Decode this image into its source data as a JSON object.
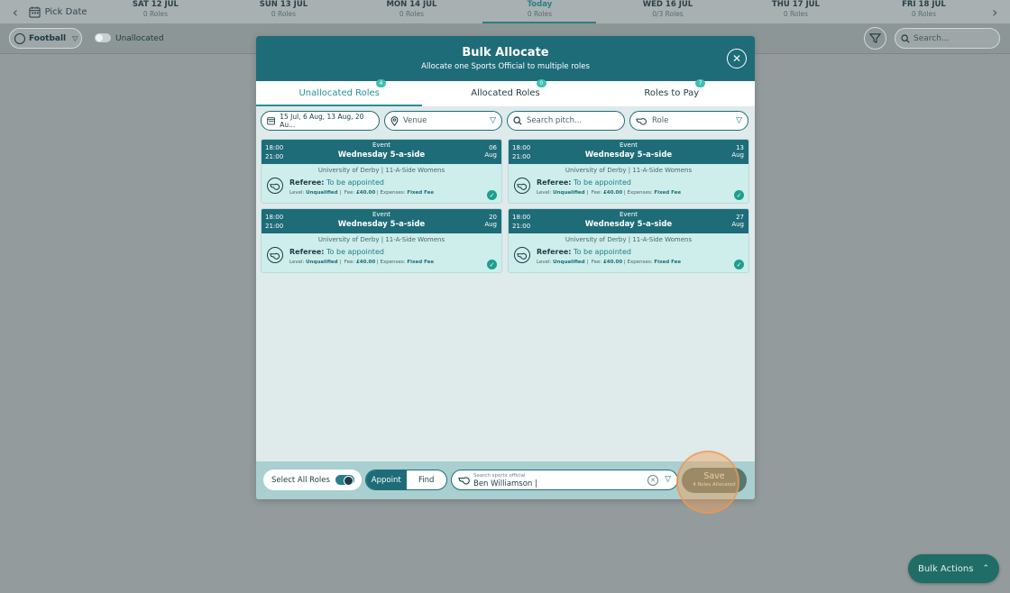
{
  "datebar": {
    "pick_date": "Pick Date",
    "days": [
      {
        "name": "SAT 12 JUL",
        "roles": "0 Roles"
      },
      {
        "name": "SUN 13 JUL",
        "roles": "0 Roles"
      },
      {
        "name": "MON 14 JUL",
        "roles": "0 Roles"
      },
      {
        "name": "Today",
        "roles": "0 Roles"
      },
      {
        "name": "WED 16 JUL",
        "roles": "0/3 Roles"
      },
      {
        "name": "THU 17 JUL",
        "roles": "0 Roles"
      },
      {
        "name": "FRI 18 JUL",
        "roles": "0 Roles"
      }
    ]
  },
  "filterbar": {
    "sport": "Football",
    "unallocated_label": "Unallocated",
    "search_placeholder": "Search..."
  },
  "modal": {
    "title": "Bulk Allocate",
    "subtitle": "Allocate one Sports Official to multiple roles",
    "tabs": [
      {
        "label": "Unallocated Roles",
        "badge": "4"
      },
      {
        "label": "Allocated Roles",
        "badge": "0"
      },
      {
        "label": "Roles to Pay",
        "badge": "7"
      }
    ],
    "filters": {
      "dates": "15 Jul, 6 Aug, 13 Aug, 20 Au...",
      "venue_placeholder": "Venue",
      "pitch_placeholder": "Search pitch...",
      "role_placeholder": "Role"
    },
    "cards": [
      {
        "start": "18:00",
        "end": "21:00",
        "type": "Event",
        "title": "Wednesday 5-a-side",
        "day": "06",
        "month": "Aug",
        "venue": "University of Derby | 11-A-Side Womens",
        "role": "Referee:",
        "status": "To be appointed",
        "level_label": "Level:",
        "level": "Unqualified",
        "fee_label": "Fee:",
        "fee": "£40.00",
        "expenses_label": "Expenses:",
        "expenses": "Fixed Fee"
      },
      {
        "start": "18:00",
        "end": "21:00",
        "type": "Event",
        "title": "Wednesday 5-a-side",
        "day": "13",
        "month": "Aug",
        "venue": "University of Derby | 11-A-Side Womens",
        "role": "Referee:",
        "status": "To be appointed",
        "level_label": "Level:",
        "level": "Unqualified",
        "fee_label": "Fee:",
        "fee": "£40.00",
        "expenses_label": "Expenses:",
        "expenses": "Fixed Fee"
      },
      {
        "start": "18:00",
        "end": "21:00",
        "type": "Event",
        "title": "Wednesday 5-a-side",
        "day": "20",
        "month": "Aug",
        "venue": "University of Derby | 11-A-Side Womens",
        "role": "Referee:",
        "status": "To be appointed",
        "level_label": "Level:",
        "level": "Unqualified",
        "fee_label": "Fee:",
        "fee": "£40.00",
        "expenses_label": "Expenses:",
        "expenses": "Fixed Fee"
      },
      {
        "start": "18:00",
        "end": "21:00",
        "type": "Event",
        "title": "Wednesday 5-a-side",
        "day": "27",
        "month": "Aug",
        "venue": "University of Derby | 11-A-Side Womens",
        "role": "Referee:",
        "status": "To be appointed",
        "level_label": "Level:",
        "level": "Unqualified",
        "fee_label": "Fee:",
        "fee": "£40.00",
        "expenses_label": "Expenses:",
        "expenses": "Fixed Fee"
      }
    ],
    "footer": {
      "select_all": "Select All Roles",
      "appoint": "Appoint",
      "find": "Find",
      "official_label": "Search sports official",
      "official_value": "Ben Williamson |",
      "save": "Save",
      "save_sub": "4 Roles Allocated"
    }
  },
  "bulk_actions": "Bulk Actions",
  "colors": {
    "primary": "#1e6c78",
    "accent": "#2a8e95",
    "badge": "#3ec0b1",
    "card_bg": "#cdeeeb",
    "check": "#1f9e8f",
    "highlight": "#f0a05a"
  }
}
